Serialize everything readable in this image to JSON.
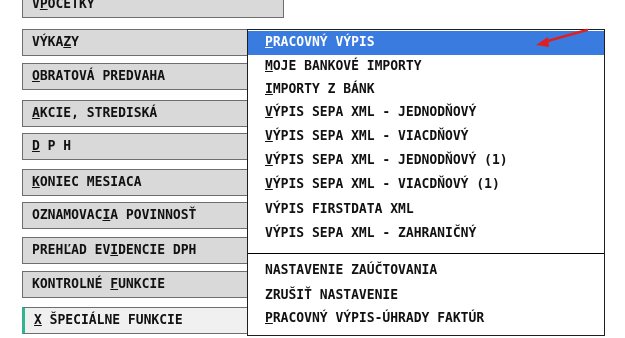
{
  "sidebar": {
    "items": [
      {
        "pre": "V",
        "ul": "P",
        "post": "OČETKY",
        "state": "normal"
      },
      {
        "pre": "VÝKA",
        "ul": "Z",
        "post": "Y",
        "state": "normal"
      },
      {
        "pre": "",
        "ul": "O",
        "post": "BRATOVÁ PREDVAHA",
        "state": "normal"
      },
      {
        "pre": "",
        "ul": "A",
        "post": "KCIE, STREDISKÁ",
        "state": "normal"
      },
      {
        "pre": "",
        "ul": "D",
        "post": " P H",
        "state": "normal"
      },
      {
        "pre": "",
        "ul": "K",
        "post": "ONIEC MESIACA",
        "state": "normal"
      },
      {
        "pre": "OZNAMOVAC",
        "ul": "I",
        "post": "A POVINNOSŤ",
        "state": "normal"
      },
      {
        "pre": "PREHĽAD EV",
        "ul": "I",
        "post": "DENCIE DPH",
        "state": "normal"
      },
      {
        "pre": "KONTROLNÉ ",
        "ul": "F",
        "post": "UNKCIE",
        "state": "normal"
      },
      {
        "pre": "",
        "ul": "X",
        "post": " ŠPECIÁLNE FUNKCIE",
        "state": "active"
      }
    ]
  },
  "dropdown": {
    "items": [
      {
        "pre": "",
        "ul": "P",
        "post": "RACOVNÝ VÝPIS",
        "selected": true
      },
      {
        "pre": "",
        "ul": "M",
        "post": "OJE BANKOVÉ IMPORTY",
        "selected": false
      },
      {
        "pre": "",
        "ul": "I",
        "post": "MPORTY Z BÁNK",
        "selected": false
      },
      {
        "pre": "",
        "ul": "V",
        "post": "ÝPIS SEPA XML - JEDNODŇOVÝ",
        "selected": false
      },
      {
        "pre": "",
        "ul": "V",
        "post": "ÝPIS SEPA XML - VIACDŇOVÝ",
        "selected": false
      },
      {
        "pre": "",
        "ul": "V",
        "post": "ÝPIS SEPA XML - JEDNODŇOVÝ (1)",
        "selected": false
      },
      {
        "pre": "",
        "ul": "V",
        "post": "ÝPIS SEPA XML - VIACDŇOVÝ (1)",
        "selected": false
      },
      {
        "pre": "VÝPIS FIRSTDATA XML",
        "ul": "",
        "post": "",
        "selected": false
      },
      {
        "pre": "VÝPIS SEPA XML - ZAHRANIČNÝ",
        "ul": "",
        "post": "",
        "selected": false
      },
      {
        "pre": "NASTAVENIE ZAÚČTOVANIA",
        "ul": "",
        "post": "",
        "selected": false
      },
      {
        "pre": "ZRUŠIŤ NASTAVENIE",
        "ul": "",
        "post": "",
        "selected": false
      },
      {
        "pre": "",
        "ul": "P",
        "post": "RACOVNÝ VÝPIS-ÚHRADY FAKTÚR",
        "selected": false
      }
    ]
  },
  "colors": {
    "selected_bg": "#3a7be0",
    "sidebar_bg": "#d9d9d9",
    "active_accent": "#2fb48f",
    "arrow": "#e02020"
  }
}
